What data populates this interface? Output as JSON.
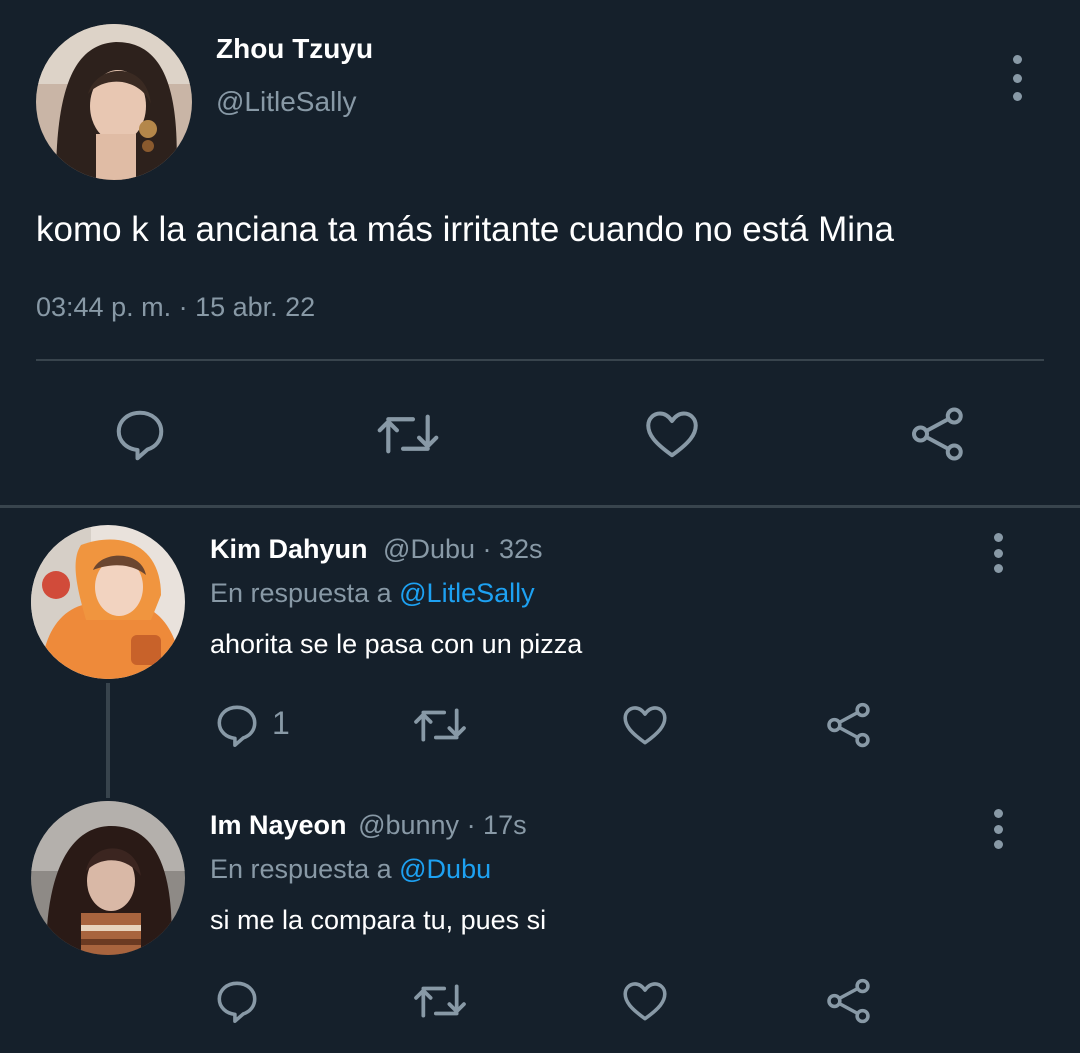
{
  "main_tweet": {
    "display_name": "Zhou Tzuyu",
    "handle": "@LitleSally",
    "text": "komo k la anciana ta más irritante cuando no está Mina",
    "timestamp": "03:44 p. m. · 15 abr. 22",
    "actions": {
      "reply_icon": "reply-icon",
      "retweet_icon": "retweet-icon",
      "like_icon": "heart-icon",
      "share_icon": "share-icon"
    }
  },
  "replies": [
    {
      "display_name": "Kim Dahyun",
      "handle": "@Dubu",
      "time": "· 32s",
      "reply_prefix": "En respuesta a",
      "reply_to": "@LitleSally",
      "text": "ahorita se le pasa con un pizza",
      "reply_count": "1"
    },
    {
      "display_name": "Im Nayeon",
      "handle": "@bunny",
      "time": "· 17s",
      "reply_prefix": "En respuesta a",
      "reply_to": "@Dubu",
      "text": "si me la compara tu, pues si",
      "reply_count": ""
    }
  ],
  "colors": {
    "background": "#15202b",
    "divider": "#38444d",
    "muted": "#8899a6",
    "link": "#1da1f2",
    "icon": "#8899a6"
  }
}
